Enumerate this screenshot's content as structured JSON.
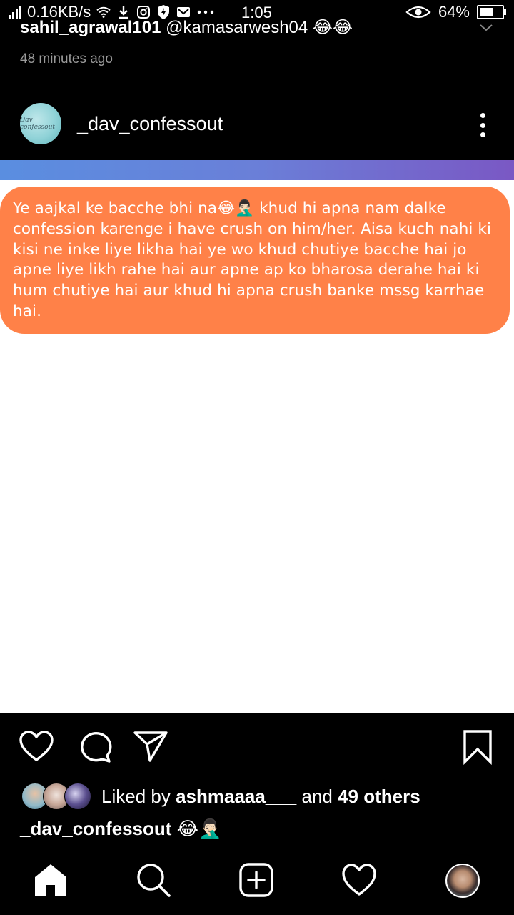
{
  "status_bar": {
    "speed": "0.16KB/s",
    "time": "1:05",
    "battery": "64%",
    "battery_level": 0.64,
    "icons": [
      "signal-icon",
      "wifi-icon",
      "download-icon",
      "instagram-icon",
      "shield-icon",
      "gmail-icon",
      "more-icon",
      "eye-icon",
      "battery-icon"
    ]
  },
  "previous_post": {
    "comment_user": "sahil_agrawal101",
    "comment_text": "@kamasarwesh04 😂😂",
    "timestamp": "48 minutes ago"
  },
  "post": {
    "username": "_dav_confessout",
    "avatar_text": "Dav confessout",
    "confession": "Ye aajkal ke bacche bhi na😂🤦🏻‍♂️ khud hi apna nam dalke confession karenge i have crush on him/her. Aisa kuch nahi ki kisi ne inke liye likha hai ye wo khud chutiye bacche hai jo apne liye likh rahe hai aur apne ap ko bharosa derahe hai ki hum chutiye hai aur khud hi apna crush banke mssg karrhae hai.",
    "likes": {
      "prefix": "Liked by",
      "user": "ashmaaaa___",
      "and": "and",
      "others": "49 others"
    },
    "caption": {
      "user": "_dav_confessout",
      "text": "😂🤦🏻‍♂️"
    }
  },
  "colors": {
    "bubble": "#ff8148",
    "gradient_start": "#5a8ee0",
    "gradient_end": "#7a58c4",
    "background": "#000000"
  },
  "bottom_nav": [
    "home-icon",
    "search-icon",
    "new-post-icon",
    "activity-heart-icon",
    "profile-avatar"
  ]
}
